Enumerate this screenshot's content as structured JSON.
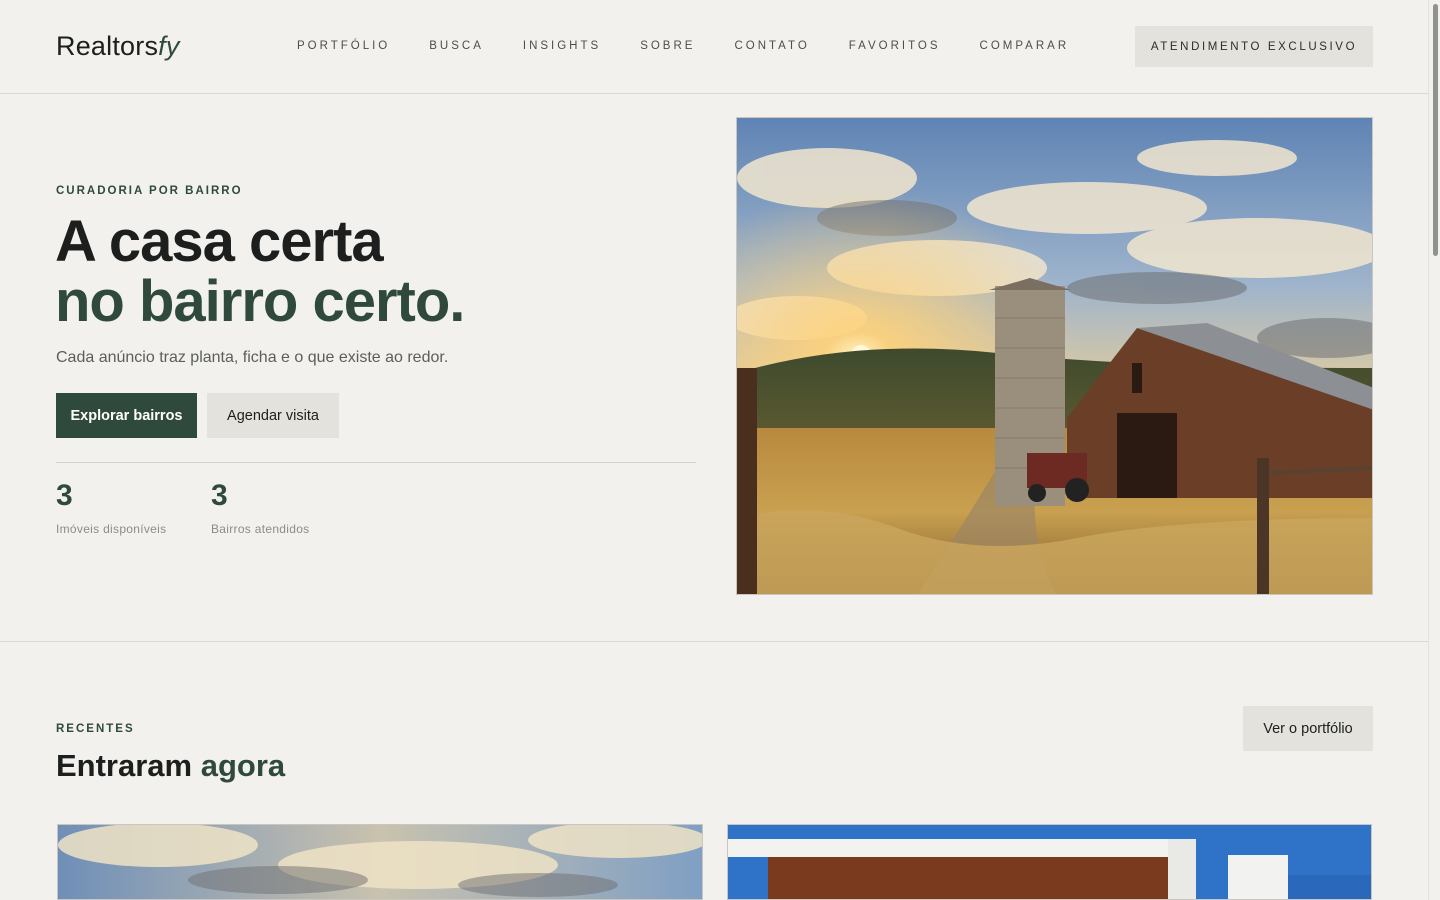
{
  "brand": {
    "name": "Realtors",
    "suffix": "fy"
  },
  "nav": {
    "items": [
      {
        "label": "PORTFÓLIO"
      },
      {
        "label": "BUSCA"
      },
      {
        "label": "INSIGHTS"
      },
      {
        "label": "SOBRE"
      },
      {
        "label": "CONTATO"
      },
      {
        "label": "FAVORITOS"
      },
      {
        "label": "COMPARAR"
      }
    ],
    "cta_label": "ATENDIMENTO EXCLUSIVO"
  },
  "hero": {
    "eyebrow": "CURADORIA POR BAIRRO",
    "title_line1": "A casa certa",
    "title_line2": "no bairro certo.",
    "subtitle": "Cada anúncio traz planta, ficha e o que existe ao redor.",
    "primary_button": "Explorar bairros",
    "secondary_button": "Agendar visita",
    "stats": [
      {
        "value": "3",
        "label": "Imóveis disponíveis"
      },
      {
        "value": "3",
        "label": "Bairros atendidos"
      }
    ]
  },
  "recent": {
    "eyebrow": "RECENTES",
    "title_part1": "Entraram",
    "title_part2": "agora",
    "portfolio_button": "Ver o portfólio"
  },
  "colors": {
    "background": "#f3f1ed",
    "accent": "#2f4a3c",
    "button_neutral": "#e4e2dd",
    "text": "#1c1f1d"
  }
}
